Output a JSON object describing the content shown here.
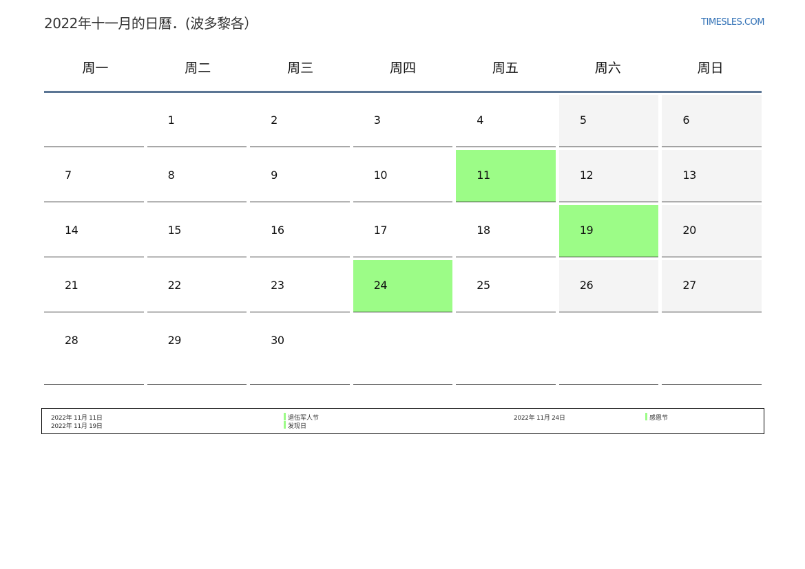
{
  "title": "2022年十一月的日曆．(波多黎各）",
  "site": "TIMESLES.COM",
  "colors": {
    "holiday": "#9cfc87",
    "weekend": "#f4f4f4",
    "header_rule": "#5b7594",
    "link": "#2f6fb5"
  },
  "weekdays": [
    "周一",
    "周二",
    "周三",
    "周四",
    "周五",
    "周六",
    "周日"
  ],
  "days": [
    "",
    "1",
    "2",
    "3",
    "4",
    "5",
    "6",
    "7",
    "8",
    "9",
    "10",
    "11",
    "12",
    "13",
    "14",
    "15",
    "16",
    "17",
    "18",
    "19",
    "20",
    "21",
    "22",
    "23",
    "24",
    "25",
    "26",
    "27",
    "28",
    "29",
    "30",
    "",
    "",
    "",
    ""
  ],
  "holiday_days": [
    "11",
    "19",
    "24"
  ],
  "legend": [
    {
      "date": "2022年 11月 11日",
      "name": "退伍军人节"
    },
    {
      "date": "2022年 11月 19日",
      "name": "发现日"
    },
    {
      "date": "2022年 11月 24日",
      "name": "感恩节"
    }
  ]
}
